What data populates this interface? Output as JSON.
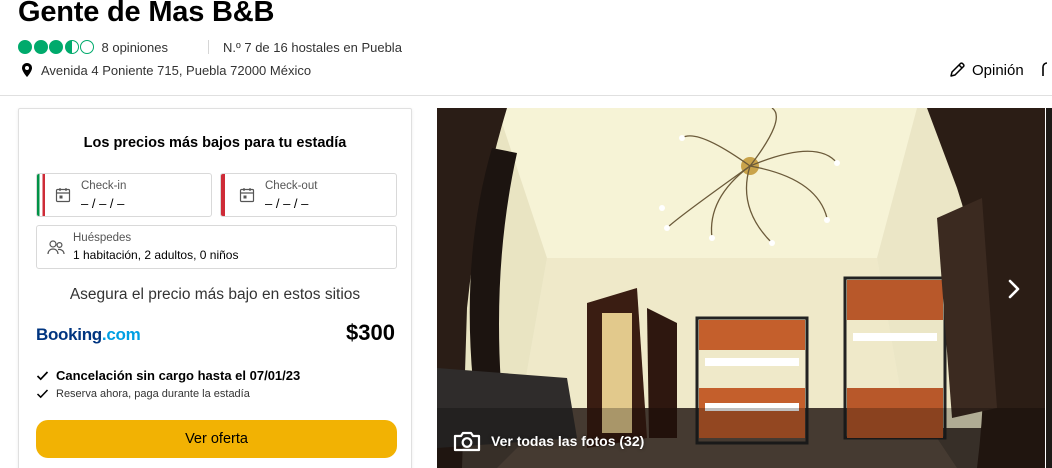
{
  "hotel": {
    "name": "Gente de Mas B&B",
    "rating_bubbles": 3.5,
    "reviews": "8 opiniones",
    "ranking": "N.º 7 de 16 hostales en Puebla",
    "address": "Avenida 4 Poniente 715, Puebla 72000 México"
  },
  "actions": {
    "review_label": "Opinión"
  },
  "booking": {
    "title": "Los precios más bajos para tu estadía",
    "checkin_label": "Check-in",
    "checkin_value": "– / – / –",
    "checkout_label": "Check-out",
    "checkout_value": "– / – / –",
    "guests_label": "Huéspedes",
    "guests_value": "1 habitación, 2 adultos, 0 niños",
    "secure_text": "Asegura el precio más bajo en estos sitios",
    "provider_main": "Booking",
    "provider_suffix": ".com",
    "price": "$300",
    "feature_1": "Cancelación sin cargo hasta el 07/01/23",
    "feature_2": "Reserva ahora, paga durante la estadía",
    "cta_label": "Ver oferta"
  },
  "gallery": {
    "see_all_label": "Ver todas las fotos (32)"
  },
  "colors": {
    "rating_green": "#00aa6c",
    "cta_yellow": "#f2b203",
    "booking_blue": "#003580",
    "booking_light": "#009fe3"
  },
  "icons": [
    "location-pin-icon",
    "pencil-icon",
    "calendar-icon",
    "people-icon",
    "checkmark-icon",
    "camera-icon",
    "chevron-right-icon"
  ]
}
